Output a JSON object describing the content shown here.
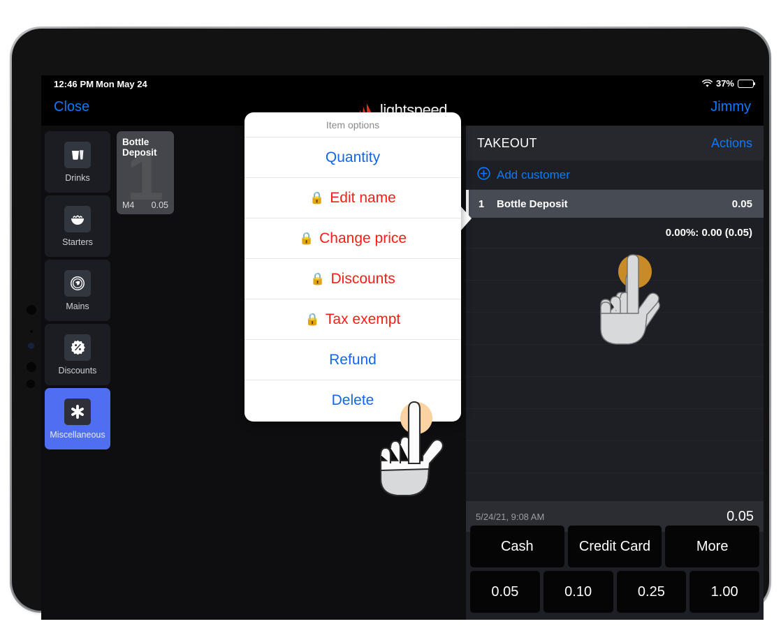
{
  "status_bar": {
    "time": "12:46 PM",
    "date": "Mon May 24",
    "battery_percent": "37%",
    "wifi_icon": "wifi-icon",
    "battery_icon": "battery-icon"
  },
  "top_nav": {
    "close_label": "Close",
    "user_label": "Jimmy",
    "brand_name": "lightspeed",
    "brand_logo_icon": "lightspeed-mountain-icon"
  },
  "sidebar": {
    "items": [
      {
        "label": "Drinks",
        "icon": "drinks-glass-icon",
        "selected": false
      },
      {
        "label": "Starters",
        "icon": "starters-bowl-icon",
        "selected": false
      },
      {
        "label": "Mains",
        "icon": "mains-plate-icon",
        "selected": false
      },
      {
        "label": "Discounts",
        "icon": "discount-percent-icon",
        "selected": false
      },
      {
        "label": "Miscellaneous",
        "icon": "asterisk-icon",
        "selected": true
      }
    ]
  },
  "products": [
    {
      "name": "Bottle Deposit",
      "watermark": "1",
      "code": "M4",
      "price": "0.05"
    }
  ],
  "modal": {
    "title": "Item options",
    "options": [
      {
        "label": "Quantity",
        "color": "blue",
        "locked": false
      },
      {
        "label": "Edit name",
        "color": "red",
        "locked": true
      },
      {
        "label": "Change price",
        "color": "red",
        "locked": true
      },
      {
        "label": "Discounts",
        "color": "red",
        "locked": true
      },
      {
        "label": "Tax exempt",
        "color": "red",
        "locked": true
      },
      {
        "label": "Refund",
        "color": "blue",
        "locked": false
      },
      {
        "label": "Delete",
        "color": "blue",
        "locked": false
      }
    ],
    "lock_glyph": "🔒"
  },
  "order": {
    "title": "TAKEOUT",
    "actions_label": "Actions",
    "add_customer_label": "Add customer",
    "add_customer_icon": "plus-circle-icon",
    "lines": [
      {
        "qty": "1",
        "name": "Bottle Deposit",
        "price": "0.05"
      }
    ],
    "tax_line": "0.00%: 0.00 (0.05)",
    "timestamp": "5/24/21, 9:08 AM",
    "total": "0.05"
  },
  "payment": {
    "methods": [
      "Cash",
      "Credit Card",
      "More"
    ],
    "amounts": [
      "0.05",
      "0.10",
      "0.25",
      "1.00"
    ]
  },
  "colors": {
    "accent_blue": "#0a7bff",
    "destructive_red": "#fb1c15",
    "selected_category": "#4f6ef2",
    "brand_red": "#e8392c",
    "tap_indicator": "#c98a28"
  }
}
